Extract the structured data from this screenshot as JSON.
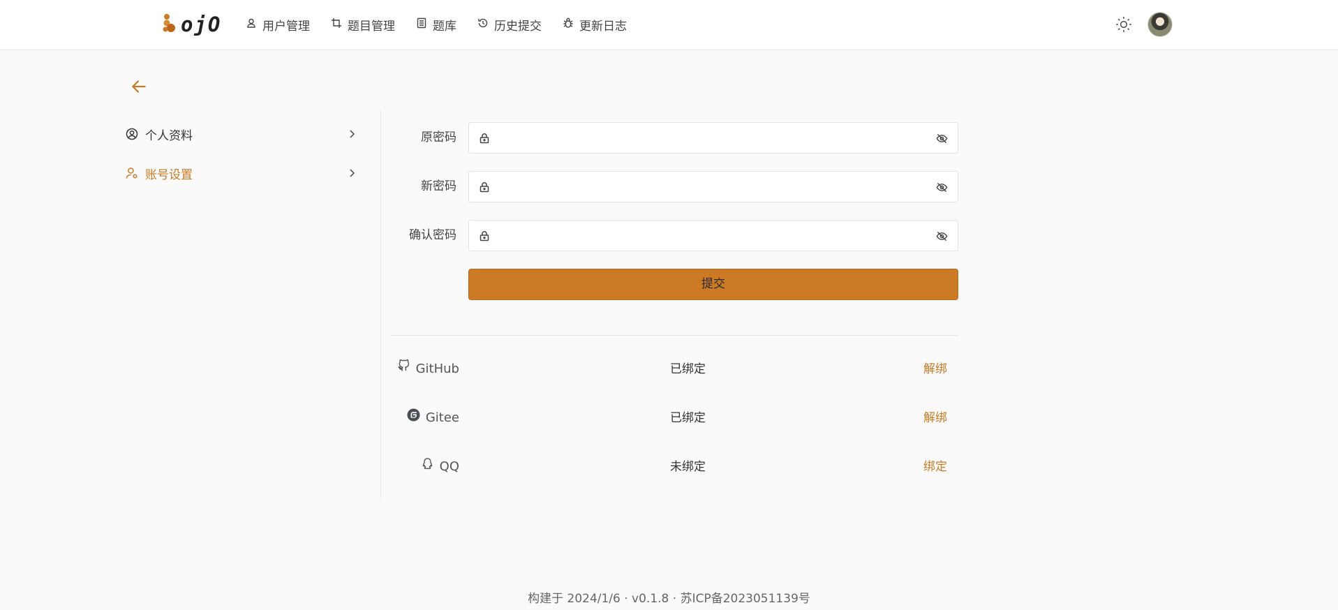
{
  "brand": {
    "logo_text": "ojO",
    "logo_icon": "cluster-dots-icon",
    "accent": "#cd7a24"
  },
  "nav": [
    {
      "label": "用户管理",
      "icon": "user-icon"
    },
    {
      "label": "题目管理",
      "icon": "crop-icon"
    },
    {
      "label": "题库",
      "icon": "list-icon"
    },
    {
      "label": "历史提交",
      "icon": "history-icon"
    },
    {
      "label": "更新日志",
      "icon": "bug-icon"
    }
  ],
  "header": {
    "theme_icon": "sun-icon",
    "avatar": "avatar"
  },
  "sidebar": {
    "items": [
      {
        "label": "个人资料",
        "icon": "user-circle-icon",
        "active": false
      },
      {
        "label": "账号设置",
        "icon": "user-settings-icon",
        "active": true
      }
    ]
  },
  "password_form": {
    "old_label": "原密码",
    "new_label": "新密码",
    "confirm_label": "确认密码",
    "old_value": "",
    "new_value": "",
    "confirm_value": "",
    "submit_label": "提交"
  },
  "bindings": [
    {
      "name": "GitHub",
      "status": "已绑定",
      "action": "解绑",
      "icon": "github-icon"
    },
    {
      "name": "Gitee",
      "status": "已绑定",
      "action": "解绑",
      "icon": "gitee-icon"
    },
    {
      "name": "QQ",
      "status": "未绑定",
      "action": "绑定",
      "icon": "qq-icon"
    }
  ],
  "footer": {
    "text": "构建于 2024/1/6 · v0.1.8 · 苏ICP备2023051139号"
  }
}
